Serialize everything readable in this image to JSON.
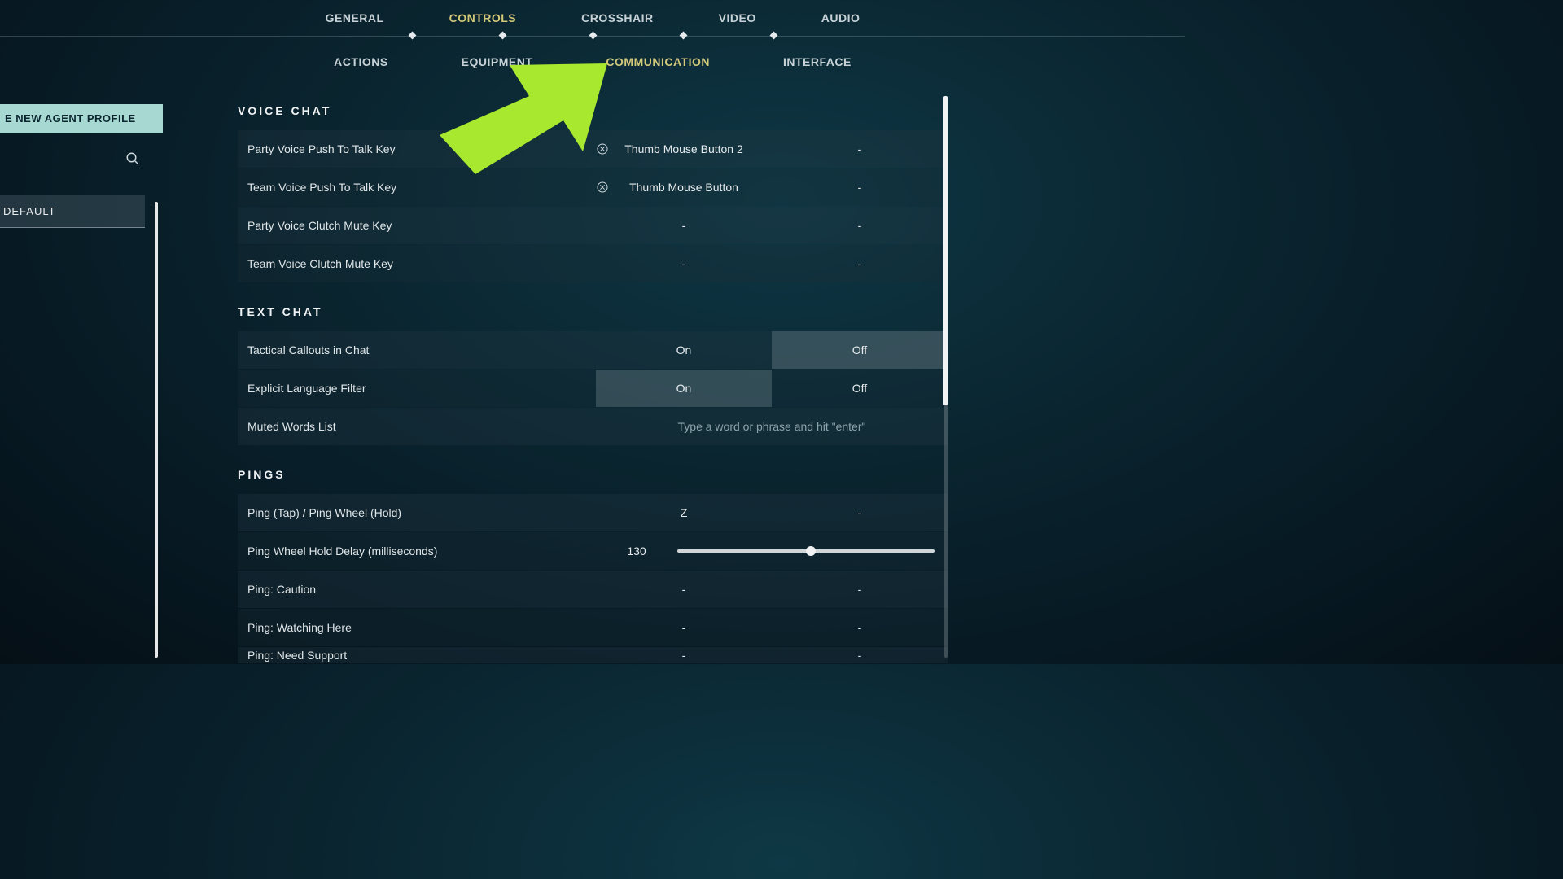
{
  "topTabs": {
    "general": "GENERAL",
    "controls": "CONTROLS",
    "crosshair": "CROSSHAIR",
    "video": "VIDEO",
    "audio": "AUDIO"
  },
  "subTabs": {
    "actions": "ACTIONS",
    "equipment": "EQUIPMENT",
    "communication": "COMMUNICATION",
    "interface": "INTERFACE"
  },
  "sidebar": {
    "createProfile": "E NEW AGENT PROFILE",
    "defaultProfile": "DEFAULT"
  },
  "sections": {
    "voiceChat": {
      "heading": "VOICE CHAT",
      "rows": [
        {
          "label": "Party Voice Push To Talk Key",
          "primary": "Thumb Mouse Button 2",
          "secondary": "-",
          "hasClear": true
        },
        {
          "label": "Team Voice Push To Talk Key",
          "primary": "Thumb Mouse Button",
          "secondary": "-",
          "hasClear": true
        },
        {
          "label": "Party Voice Clutch Mute Key",
          "primary": "-",
          "secondary": "-",
          "hasClear": false
        },
        {
          "label": "Team Voice Clutch Mute Key",
          "primary": "-",
          "secondary": "-",
          "hasClear": false
        }
      ]
    },
    "textChat": {
      "heading": "TEXT CHAT",
      "tactical": {
        "label": "Tactical Callouts in Chat",
        "on": "On",
        "off": "Off",
        "selected": "Off"
      },
      "explicit": {
        "label": "Explicit Language Filter",
        "on": "On",
        "off": "Off",
        "selected": "On"
      },
      "muted": {
        "label": "Muted Words List",
        "placeholder": "Type a word or phrase and hit \"enter\""
      }
    },
    "pings": {
      "heading": "PINGS",
      "pingWheel": {
        "label": "Ping (Tap) / Ping Wheel (Hold)",
        "primary": "Z",
        "secondary": "-"
      },
      "holdDelay": {
        "label": "Ping Wheel Hold Delay (milliseconds)",
        "value": "130",
        "percent": 52
      },
      "caution": {
        "label": "Ping: Caution",
        "primary": "-",
        "secondary": "-"
      },
      "watching": {
        "label": "Ping: Watching Here",
        "primary": "-",
        "secondary": "-"
      },
      "needSupport": {
        "label": "Ping: Need Support",
        "primary": "-",
        "secondary": "-"
      }
    }
  }
}
